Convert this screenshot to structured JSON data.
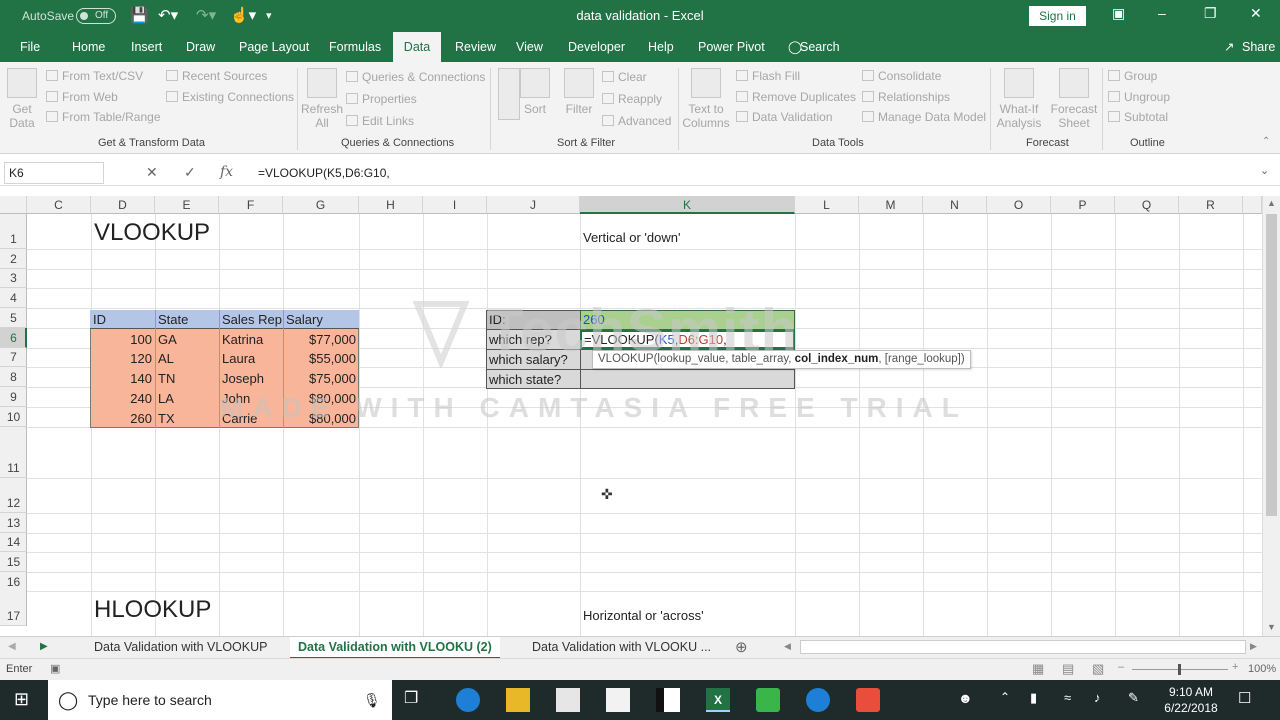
{
  "title_bar": {
    "autosave_label": "AutoSave",
    "autosave_state": "Off",
    "document_title": "data validation  -  Excel",
    "signin_label": "Sign in"
  },
  "ribbon_tabs": [
    "File",
    "Home",
    "Insert",
    "Draw",
    "Page Layout",
    "Formulas",
    "Data",
    "Review",
    "View",
    "Developer",
    "Help",
    "Power Pivot",
    "Search"
  ],
  "active_tab": "Data",
  "share_label": "Share",
  "ribbon": {
    "get_data": "Get Data",
    "get_transform": {
      "from_text": "From Text/CSV",
      "from_web": "From Web",
      "from_table": "From Table/Range",
      "recent": "Recent Sources",
      "existing": "Existing Connections",
      "label": "Get & Transform Data"
    },
    "queries": {
      "refresh": "Refresh All",
      "queries": "Queries & Connections",
      "properties": "Properties",
      "edit_links": "Edit Links",
      "label": "Queries & Connections"
    },
    "sort_filter": {
      "sort": "Sort",
      "filter": "Filter",
      "clear": "Clear",
      "reapply": "Reapply",
      "advanced": "Advanced",
      "label": "Sort & Filter"
    },
    "data_tools": {
      "text_to_columns": "Text to Columns",
      "flash_fill": "Flash Fill",
      "remove_dup": "Remove Duplicates",
      "data_validation": "Data Validation",
      "consolidate": "Consolidate",
      "relationships": "Relationships",
      "manage_model": "Manage Data Model",
      "label": "Data Tools"
    },
    "forecast": {
      "what_if": "What-If Analysis",
      "forecast_sheet": "Forecast Sheet",
      "label": "Forecast"
    },
    "outline": {
      "group": "Group",
      "ungroup": "Ungroup",
      "subtotal": "Subtotal",
      "label": "Outline"
    }
  },
  "formula_bar": {
    "name_box": "K6",
    "formula": "=VLOOKUP(K5,D6:G10,"
  },
  "columns": [
    "C",
    "D",
    "E",
    "F",
    "G",
    "H",
    "I",
    "J",
    "K",
    "L",
    "M",
    "N",
    "O",
    "P",
    "Q",
    "R"
  ],
  "rows": [
    "1",
    "2",
    "3",
    "4",
    "5",
    "6",
    "7",
    "8",
    "9",
    "10",
    "11",
    "12",
    "13",
    "14",
    "15",
    "16",
    "17"
  ],
  "cells": {
    "d1": "VLOOKUP",
    "k1": "Vertical or 'down'",
    "d17": "HLOOKUP",
    "k17": "Horizontal or 'across'",
    "table_headers": [
      "ID",
      "State",
      "Sales Rep",
      "Salary"
    ],
    "table_rows": [
      [
        "100",
        "GA",
        "Katrina",
        "$77,000"
      ],
      [
        "120",
        "AL",
        "Laura",
        "$55,000"
      ],
      [
        "140",
        "TN",
        "Joseph",
        "$75,000"
      ],
      [
        "240",
        "LA",
        "John",
        "$80,000"
      ],
      [
        "260",
        "TX",
        "Carrie",
        "$80,000"
      ]
    ],
    "lookup_labels": [
      "ID:",
      "which rep?",
      "which salary?",
      "which state?"
    ],
    "k5": "260",
    "k6_formula_prefix": "=VLOOKUP(",
    "k6_ref1": "K5",
    "k6_comma": ",",
    "k6_ref2": "D6:G10",
    "k6_suffix": ",",
    "tooltip_prefix": "VLOOKUP(lookup_value, table_array, ",
    "tooltip_bold": "col_index_num",
    "tooltip_suffix": ", [range_lookup])"
  },
  "sheet_tabs": [
    "Data Validation with VLOOKUP",
    "Data Validation with VLOOKU (2)",
    "Data Validation with VLOOKU ..."
  ],
  "active_sheet": 1,
  "status": {
    "mode": "Enter",
    "zoom": "100%"
  },
  "taskbar": {
    "search_placeholder": "Type here to search",
    "time": "9:10 AM",
    "date": "6/22/2018"
  },
  "watermark": {
    "brand": "TechSmith",
    "trial": "MADE WITH CAMTASIA FREE TRIAL"
  },
  "colors": {
    "excel_green": "#217346",
    "table_header": "#b4c6e7",
    "table_body": "#f8b59a",
    "lookup_label": "#bfbfbf",
    "lookup_value": "#a9d08e"
  }
}
